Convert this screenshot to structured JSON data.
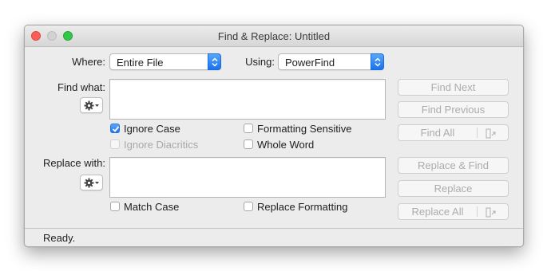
{
  "window": {
    "title": "Find & Replace: Untitled"
  },
  "where": {
    "label": "Where:",
    "value": "Entire File"
  },
  "using": {
    "label": "Using:",
    "value": "PowerFind"
  },
  "find": {
    "label": "Find what:",
    "value": ""
  },
  "replace": {
    "label": "Replace with:",
    "value": ""
  },
  "options": {
    "ignore_case": {
      "label": "Ignore Case",
      "checked": true
    },
    "formatting_sensitive": {
      "label": "Formatting Sensitive",
      "checked": false
    },
    "ignore_diacritics": {
      "label": "Ignore Diacritics",
      "checked": false,
      "disabled": true
    },
    "whole_word": {
      "label": "Whole Word",
      "checked": false
    },
    "match_case": {
      "label": "Match Case",
      "checked": false
    },
    "replace_formatting": {
      "label": "Replace Formatting",
      "checked": false
    }
  },
  "buttons": {
    "find_next": "Find Next",
    "find_previous": "Find Previous",
    "find_all": "Find All",
    "replace_and_find": "Replace & Find",
    "replace": "Replace",
    "replace_all": "Replace All"
  },
  "status": {
    "text": "Ready."
  },
  "colors": {
    "accent": "#1b72ec",
    "close": "#fc5f57",
    "maximize": "#34c84a"
  }
}
